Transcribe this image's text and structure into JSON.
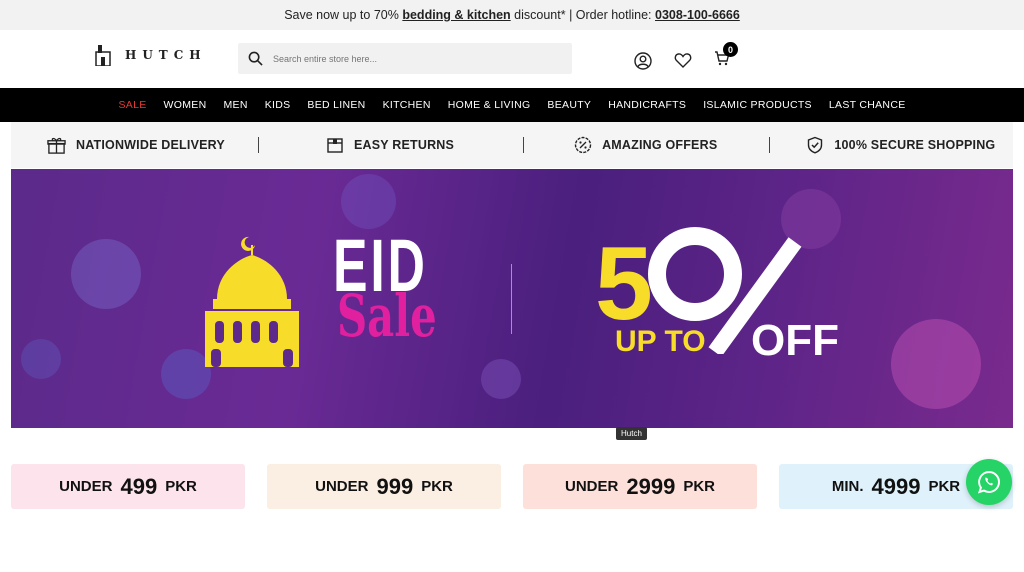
{
  "promo": {
    "prefix": "Save now up to 70%",
    "highlight": "bedding & kitchen",
    "suffix": "discount* | Order hotline:",
    "hotline": "0308-100-6666"
  },
  "header": {
    "brand": "HUTCH",
    "search_placeholder": "Search entire store here...",
    "cart_count": "0"
  },
  "nav": [
    "SALE",
    "WOMEN",
    "MEN",
    "KIDS",
    "BED LINEN",
    "KITCHEN",
    "HOME & LIVING",
    "BEAUTY",
    "HANDICRAFTS",
    "ISLAMIC PRODUCTS",
    "LAST CHANCE"
  ],
  "features": [
    "NATIONWIDE DELIVERY",
    "EASY RETURNS",
    "AMAZING OFFERS",
    "100% SECURE SHOPPING"
  ],
  "banner": {
    "title_top": "EID",
    "title_bottom": "Sale",
    "discount_number": "50",
    "up_to": "UP TO",
    "off": "OFF",
    "tooltip": "Hutch"
  },
  "price_tiles": [
    {
      "prefix": "UNDER",
      "amount": "499",
      "currency": "PKR",
      "bg": "#fde3ec"
    },
    {
      "prefix": "UNDER",
      "amount": "999",
      "currency": "PKR",
      "bg": "#fbeee2"
    },
    {
      "prefix": "UNDER",
      "amount": "2999",
      "currency": "PKR",
      "bg": "#fde0da"
    },
    {
      "prefix": "MIN.",
      "amount": "4999",
      "currency": "PKR",
      "bg": "#dff2fb"
    }
  ],
  "colors": {
    "sale_red": "#e53935",
    "whatsapp_green": "#25d366",
    "banner_yellow": "#f7dd2a",
    "banner_pink": "#e0209e"
  },
  "icons": [
    "search-icon",
    "account-icon",
    "wishlist-icon",
    "cart-icon",
    "gift-icon",
    "return-box-icon",
    "percent-badge-icon",
    "shield-check-icon",
    "mosque-icon",
    "whatsapp-icon"
  ]
}
